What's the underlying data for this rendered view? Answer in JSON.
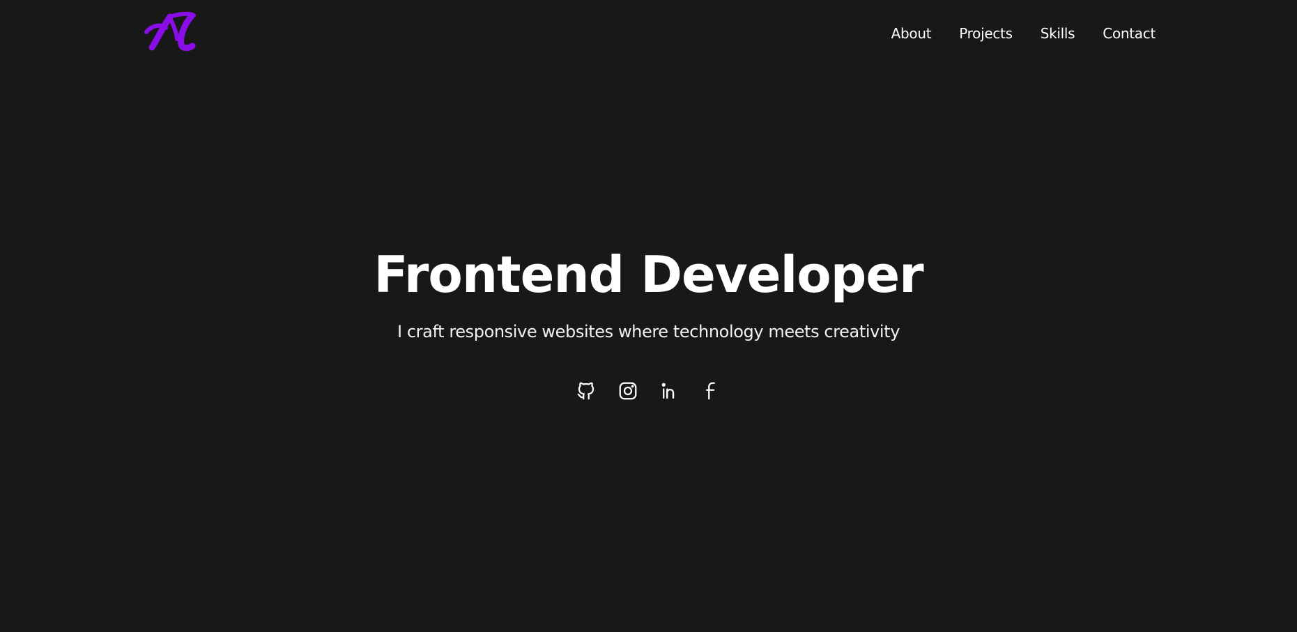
{
  "header": {
    "logo_letter": "A",
    "logo_color": "#8b0ee8",
    "nav": [
      {
        "label": "About"
      },
      {
        "label": "Projects"
      },
      {
        "label": "Skills"
      },
      {
        "label": "Contact"
      }
    ]
  },
  "hero": {
    "title": "Frontend Developer",
    "subtitle": "I craft responsive websites where technology meets creativity"
  },
  "socials": [
    {
      "icon": "github-icon"
    },
    {
      "icon": "instagram-icon"
    },
    {
      "icon": "linkedin-icon"
    },
    {
      "icon": "facebook-icon"
    }
  ],
  "colors": {
    "background": "#181818",
    "text": "#ffffff",
    "accent": "#8b0ee8"
  }
}
